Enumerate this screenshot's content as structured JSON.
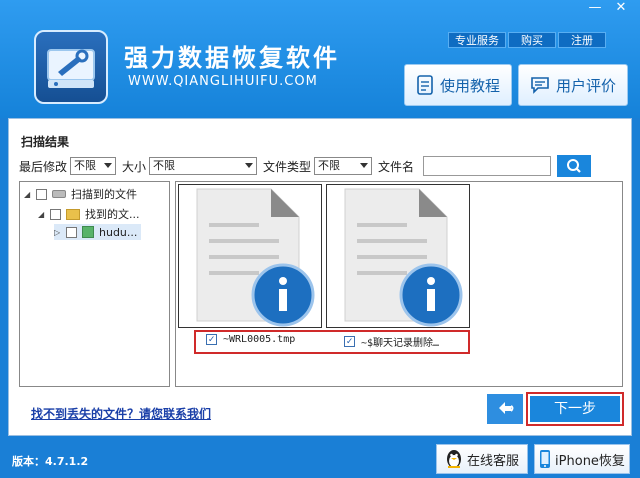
{
  "app": {
    "title": "强力数据恢复软件",
    "url": "WWW.QIANGLIHUIFU.COM",
    "version": "版本：4.7.1.2"
  },
  "window_controls": {
    "minimize": "—",
    "close": "✕"
  },
  "top_links": [
    "专业服务",
    "购买",
    "注册"
  ],
  "header_buttons": {
    "tutorial": "使用教程",
    "review": "用户评价"
  },
  "scan": {
    "title": "扫描结果",
    "filters": {
      "modified_label": "最后修改",
      "modified_value": "不限",
      "size_label": "大小",
      "size_value": "不限",
      "type_label": "文件类型",
      "type_value": "不限",
      "name_label": "文件名",
      "name_value": ""
    }
  },
  "tree": {
    "root": "扫描到的文件",
    "child": "找到的文...",
    "leaf": "hudu..."
  },
  "files": [
    {
      "name": "~WRL0005.tmp",
      "checked": true
    },
    {
      "name": "~$聊天记录删除…",
      "checked": true
    }
  ],
  "help_link": "找不到丢失的文件？请您联系我们",
  "next_button": "下一步",
  "footer": {
    "online_service": "在线客服",
    "iphone_recovery": "iPhone恢复"
  },
  "colors": {
    "brand_blue": "#1a86dc",
    "highlight_red": "#d02a2a",
    "header_blue": "#2f9cf0"
  }
}
